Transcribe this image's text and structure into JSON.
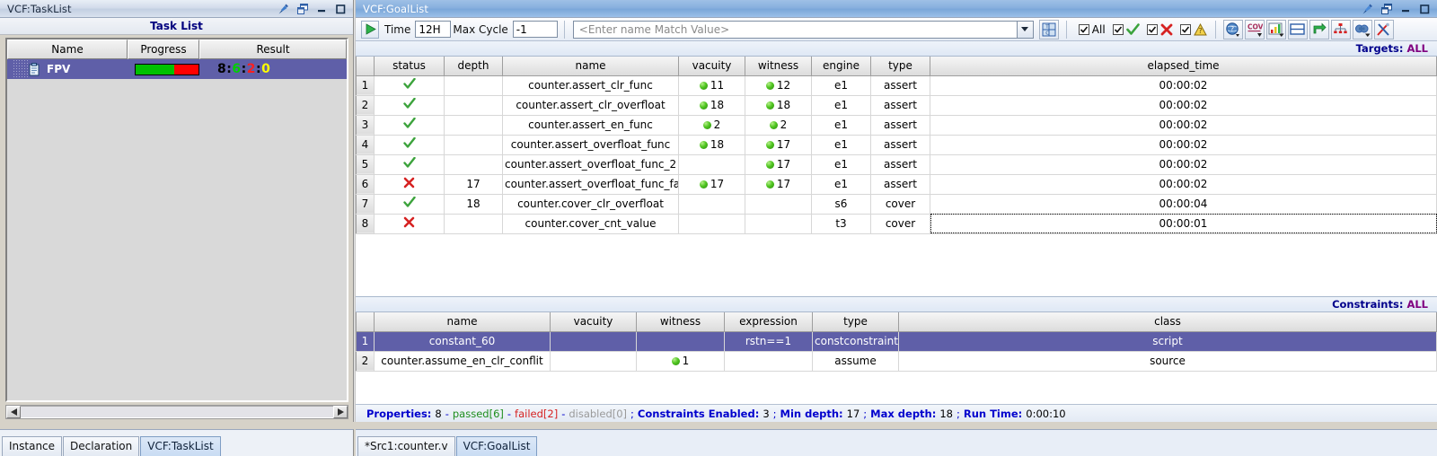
{
  "left_window": {
    "title": "VCF:TaskList",
    "heading": "Task List",
    "columns": [
      "Name",
      "Progress",
      "Result"
    ],
    "rows": [
      {
        "name": "FPV",
        "progress_percent": 62,
        "result": {
          "total": "8",
          "passed": "6",
          "failed": "2",
          "other": "0",
          "separator": ":"
        }
      }
    ],
    "window_buttons": [
      "pin-icon",
      "undock-icon",
      "minimize-icon",
      "maximize-icon"
    ]
  },
  "right_window": {
    "title": "VCF:GoalList",
    "window_buttons": [
      "pin-icon",
      "undock-icon",
      "minimize-icon",
      "maximize-icon"
    ],
    "toolbar": {
      "run_button": "run-icon",
      "time_label": "Time",
      "time_value": "12H",
      "max_cycle_label": "Max Cycle",
      "max_cycle_value": "-1",
      "match_placeholder": "<Enter name Match Value>",
      "match_value": "",
      "grid_button": "table-config-icon",
      "filters": [
        {
          "name": "filter-all",
          "label": "All",
          "checked": true,
          "glyph": ""
        },
        {
          "name": "filter-passed",
          "label": "",
          "checked": true,
          "glyph": "check"
        },
        {
          "name": "filter-failed",
          "label": "",
          "checked": true,
          "glyph": "cross"
        },
        {
          "name": "filter-warning",
          "label": "",
          "checked": true,
          "glyph": "warning"
        }
      ],
      "tools": [
        "help-globe-icon",
        "coverage-icon",
        "bar-chart-icon",
        "panel-icon",
        "refresh-icon",
        "hierarchy-icon",
        "compare-icon",
        "tools-icon"
      ]
    },
    "targets": {
      "label": "Targets:",
      "value": "ALL"
    },
    "goal_columns": [
      "",
      "status",
      "depth",
      "name",
      "vacuity",
      "witness",
      "engine",
      "type",
      "elapsed_time"
    ],
    "goal_rows": [
      {
        "num": "1",
        "status": "pass",
        "depth": "",
        "name": "counter.assert_clr_func",
        "vacuity": "11",
        "witness": "12",
        "engine": "e1",
        "type": "assert",
        "elapsed_time": "00:00:02",
        "selected": false
      },
      {
        "num": "2",
        "status": "pass",
        "depth": "",
        "name": "counter.assert_clr_overfloat",
        "vacuity": "18",
        "witness": "18",
        "engine": "e1",
        "type": "assert",
        "elapsed_time": "00:00:02",
        "selected": false
      },
      {
        "num": "3",
        "status": "pass",
        "depth": "",
        "name": "counter.assert_en_func",
        "vacuity": "2",
        "witness": "2",
        "engine": "e1",
        "type": "assert",
        "elapsed_time": "00:00:02",
        "selected": false
      },
      {
        "num": "4",
        "status": "pass",
        "depth": "",
        "name": "counter.assert_overfloat_func",
        "vacuity": "18",
        "witness": "17",
        "engine": "e1",
        "type": "assert",
        "elapsed_time": "00:00:02",
        "selected": false
      },
      {
        "num": "5",
        "status": "pass",
        "depth": "",
        "name": "counter.assert_overfloat_func_2",
        "vacuity": "",
        "witness": "17",
        "engine": "e1",
        "type": "assert",
        "elapsed_time": "00:00:02",
        "selected": false
      },
      {
        "num": "6",
        "status": "fail",
        "depth": "17",
        "name": "counter.assert_overfloat_func_fail",
        "vacuity": "17",
        "witness": "17",
        "engine": "e1",
        "type": "assert",
        "elapsed_time": "00:00:02",
        "selected": false
      },
      {
        "num": "7",
        "status": "pass",
        "depth": "18",
        "name": "counter.cover_clr_overfloat",
        "vacuity": "",
        "witness": "",
        "engine": "s6",
        "type": "cover",
        "elapsed_time": "00:00:04",
        "selected": false
      },
      {
        "num": "8",
        "status": "fail",
        "depth": "",
        "name": "counter.cover_cnt_value",
        "vacuity": "",
        "witness": "",
        "engine": "t3",
        "type": "cover",
        "elapsed_time": "00:00:01",
        "selected": false,
        "focus_cell": "elapsed_time"
      }
    ],
    "constraints": {
      "label": "Constraints:",
      "value": "ALL"
    },
    "constraint_columns": [
      "",
      "name",
      "vacuity",
      "witness",
      "expression",
      "type",
      "class"
    ],
    "constraint_rows": [
      {
        "num": "1",
        "name": "constant_60",
        "vacuity": "",
        "witness": "",
        "expression": "rstn==1",
        "type": "constconstraint",
        "class": "script",
        "selected": true
      },
      {
        "num": "2",
        "name": "counter.assume_en_clr_conflit",
        "vacuity": "",
        "witness": "1",
        "expression": "",
        "type": "assume",
        "class": "source",
        "selected": false
      }
    ],
    "status": {
      "properties_label": "Properties:",
      "properties_count": "8",
      "passed": "passed[6]",
      "failed": "failed[2]",
      "disabled": "disabled[0]",
      "constraints_label": "Constraints Enabled:",
      "constraints_count": "3",
      "min_depth_label": "Min depth:",
      "min_depth": "17",
      "max_depth_label": "Max depth:",
      "max_depth": "18",
      "run_time_label": "Run Time:",
      "run_time": "0:00:10"
    }
  },
  "bottom_tabs_left": [
    {
      "label": "Instance",
      "active": false
    },
    {
      "label": "Declaration",
      "active": false
    },
    {
      "label": "VCF:TaskList",
      "active": true
    }
  ],
  "bottom_tabs_right": [
    {
      "label": "*Src1:counter.v",
      "active": false
    },
    {
      "label": "VCF:GoalList",
      "active": true
    }
  ],
  "colors": {
    "selection": "#5f5fa8",
    "name_text": "#8b1a1a",
    "depth_text": "#0000cd",
    "pass": "#3ca33c",
    "fail": "#d62222",
    "accent_header": "#00008b",
    "accent_value": "#800080"
  }
}
